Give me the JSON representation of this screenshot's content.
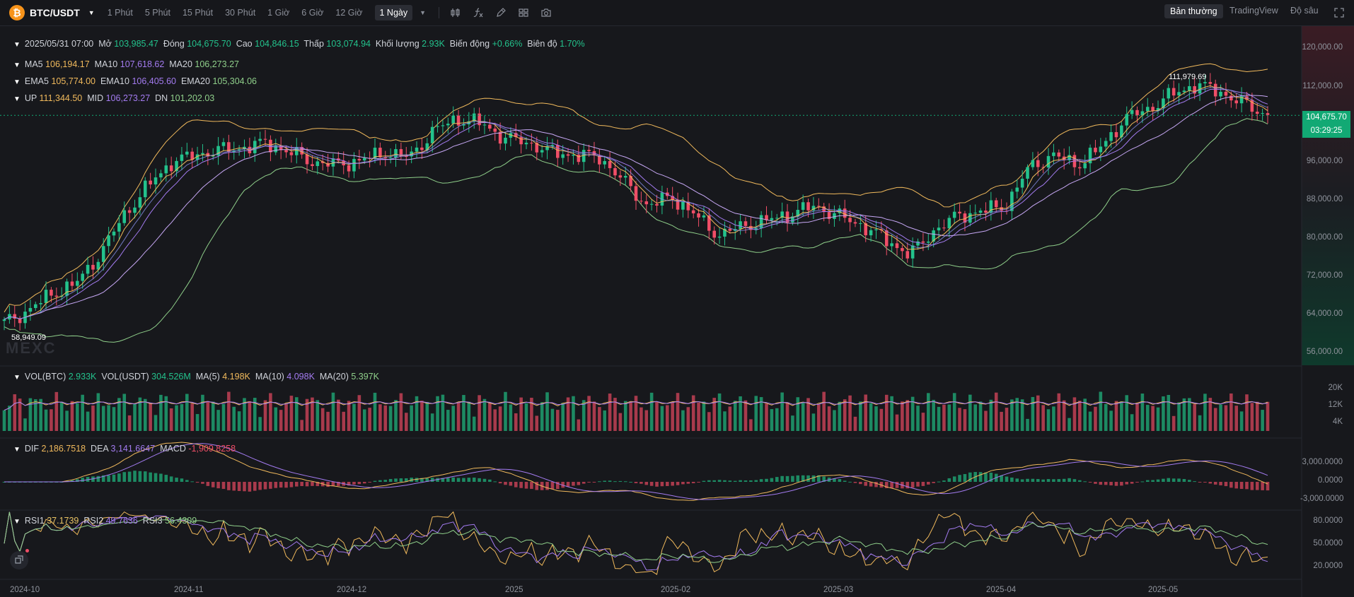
{
  "header": {
    "coin_icon": "bitcoin-icon",
    "coin_glyph": "₿",
    "pair": "BTC/USDT",
    "timeframes": [
      "1 Phút",
      "5 Phút",
      "15 Phút",
      "30 Phút",
      "1 Giờ",
      "6 Giờ",
      "12 Giờ"
    ],
    "active_timeframe": "1 Ngày",
    "modes": [
      "Bản thường",
      "TradingView",
      "Độ sâu"
    ]
  },
  "ohlc": {
    "date": "2025/05/31 07:00",
    "open_label": "Mở",
    "open": "103,985.47",
    "close_label": "Đóng",
    "close": "104,675.70",
    "high_label": "Cao",
    "high": "104,846.15",
    "low_label": "Thấp",
    "low": "103,074.94",
    "vol_label": "Khối lượng",
    "volume": "2.93K",
    "chg_label": "Biến động",
    "change": "+0.66%",
    "amp_label": "Biên độ",
    "amplitude": "1.70%"
  },
  "ma": {
    "ma5_label": "MA5",
    "ma5": "106,194.17",
    "ma10_label": "MA10",
    "ma10": "107,618.62",
    "ma20_label": "MA20",
    "ma20": "106,273.27"
  },
  "ema": {
    "ema5_label": "EMA5",
    "ema5": "105,774.00",
    "ema10_label": "EMA10",
    "ema10": "106,405.60",
    "ema20_label": "EMA20",
    "ema20": "105,304.06"
  },
  "boll": {
    "up_label": "UP",
    "up": "111,344.50",
    "mid_label": "MID",
    "mid": "106,273.27",
    "dn_label": "DN",
    "dn": "101,202.03"
  },
  "vol": {
    "btc_label": "VOL(BTC)",
    "btc": "2.933K",
    "usdt_label": "VOL(USDT)",
    "usdt": "304.526M",
    "ma5_label": "MA(5)",
    "ma5": "4.198K",
    "ma10_label": "MA(10)",
    "ma10": "4.098K",
    "ma20_label": "MA(20)",
    "ma20": "5.397K"
  },
  "macd": {
    "dif_label": "DIF",
    "dif": "2,186.7518",
    "dea_label": "DEA",
    "dea": "3,141.6647",
    "macd_label": "MACD",
    "macd": "-1,909.8258"
  },
  "rsi": {
    "rsi1_label": "RSI1",
    "rsi1": "37.1739",
    "rsi2_label": "RSI2",
    "rsi2": "49.7636",
    "rsi3_label": "RSI3",
    "rsi3": "56.4309"
  },
  "price_axis": [
    "120,000.00",
    "112,000.00",
    "104,000.00",
    "96,000.00",
    "88,000.00",
    "80,000.00",
    "72,000.00",
    "64,000.00",
    "56,000.00"
  ],
  "vol_axis": [
    "20K",
    "12K",
    "4K"
  ],
  "macd_axis": [
    "3,000.0000",
    "0.0000",
    "-3,000.0000"
  ],
  "rsi_axis": [
    "80.0000",
    "50.0000",
    "20.0000"
  ],
  "time_axis": [
    "2024-10",
    "2024-11",
    "2024-12",
    "2025",
    "2025-02",
    "2025-03",
    "2025-04",
    "2025-05"
  ],
  "current_price": "104,675.70",
  "countdown": "03:29:25",
  "high_marker": "111,979.69",
  "low_marker": "58,949.09",
  "watermark": "MEXC",
  "colors": {
    "up": "#23c28c",
    "down": "#f04e67",
    "ma5": "#f0b95c",
    "ma10": "#a37bf0",
    "ma20": "#8fcf8a"
  },
  "chart_data": {
    "type": "candlestick",
    "interval": "1 Ngày",
    "x": [
      "2024-10",
      "2024-11",
      "2024-12",
      "2025",
      "2025-02",
      "2025-03",
      "2025-04",
      "2025-05"
    ],
    "approx_close": [
      62000,
      64500,
      68000,
      70000,
      76000,
      84000,
      90000,
      95000,
      96500,
      97500,
      98000,
      99000,
      97000,
      95000,
      94500,
      95500,
      97000,
      96000,
      101500,
      104000,
      103000,
      100000,
      99000,
      97000,
      96500,
      96000,
      91000,
      86000,
      88000,
      84000,
      80000,
      82000,
      83000,
      84500,
      86000,
      84000,
      82000,
      79000,
      76000,
      81000,
      84000,
      85000,
      86000,
      94000,
      96500,
      94500,
      98000,
      104000,
      106000,
      109000,
      111000,
      109500,
      107000,
      104675.7
    ],
    "ylim": [
      54000,
      122000
    ]
  }
}
